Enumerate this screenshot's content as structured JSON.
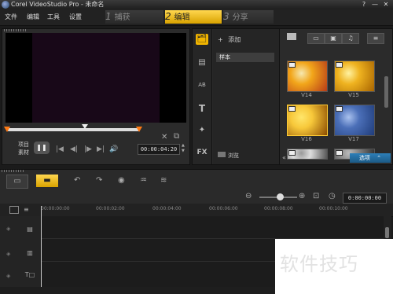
{
  "window": {
    "title": "Corel VideoStudio Pro - 未命名",
    "help_glyph": "?",
    "minimize_glyph": "—",
    "close_glyph": "✕"
  },
  "menu": [
    "文件",
    "编辑",
    "工具",
    "设置"
  ],
  "steps": [
    {
      "num": "1",
      "label": "捕获"
    },
    {
      "num": "2",
      "label": "编辑"
    },
    {
      "num": "3",
      "label": "分享"
    }
  ],
  "preview": {
    "project_label": "项目",
    "clip_label": "素材",
    "timecode": "00:00:04:20",
    "pause_glyph": "❚❚",
    "controls": [
      "|◀",
      "◀|",
      "|▶",
      "▶|",
      "🔊"
    ],
    "scissor_glyph": "✕",
    "copy_glyph": "⧉",
    "spin_up": "▲",
    "spin_down": "▼"
  },
  "library": {
    "add_glyph": "+",
    "add_label": "添加",
    "folder_item": "样本",
    "browse_label": "浏览",
    "side_icons": [
      "🗂",
      "▤",
      "AB",
      "T",
      "✦",
      "FX"
    ],
    "top_buttons": [
      "▭",
      "▣",
      "♫"
    ],
    "thumbs": [
      {
        "caption": "V14",
        "colors": [
          "#f2a61a",
          "#b63a18",
          "#f6e8b0"
        ],
        "selected": false
      },
      {
        "caption": "V15",
        "colors": [
          "#efb320",
          "#a86400",
          "#fff2a0"
        ],
        "selected": false
      },
      {
        "caption": "V16",
        "colors": [
          "#f7c83a",
          "#8a4a00",
          "#ffe66b"
        ],
        "selected": true
      },
      {
        "caption": "V17",
        "colors": [
          "#4b6fb8",
          "#1f3c7a",
          "#a9c1ee"
        ],
        "selected": false
      },
      {
        "caption": "",
        "colors": [
          "#ddd",
          "#555",
          "#999"
        ],
        "selected": false
      },
      {
        "caption": "",
        "colors": [
          "#888",
          "#333",
          "#bbb"
        ],
        "selected": false
      }
    ],
    "options_label": "选项",
    "options_glyph": "⌃",
    "collapse_glyph": "«"
  },
  "timeline": {
    "undo_glyph": "↶",
    "redo_glyph": "↷",
    "record_glyph": "◉",
    "audio_glyph": "♒",
    "mix_glyph": "≋",
    "zoom_out_glyph": "⊖",
    "zoom_in_glyph": "⊕",
    "fit_glyph": "⊡",
    "clock_glyph": "◷",
    "timecode": "0:00:00:00",
    "ruler_ticks": [
      "00:00:00:00",
      "00:00:02:00",
      "00:00:04:00",
      "00:00:06:00",
      "00:00:08:00",
      "00:00:10:00"
    ],
    "track_icons": [
      "▤",
      "▥",
      "T□"
    ]
  },
  "watermark": {
    "text": "软件技巧"
  }
}
